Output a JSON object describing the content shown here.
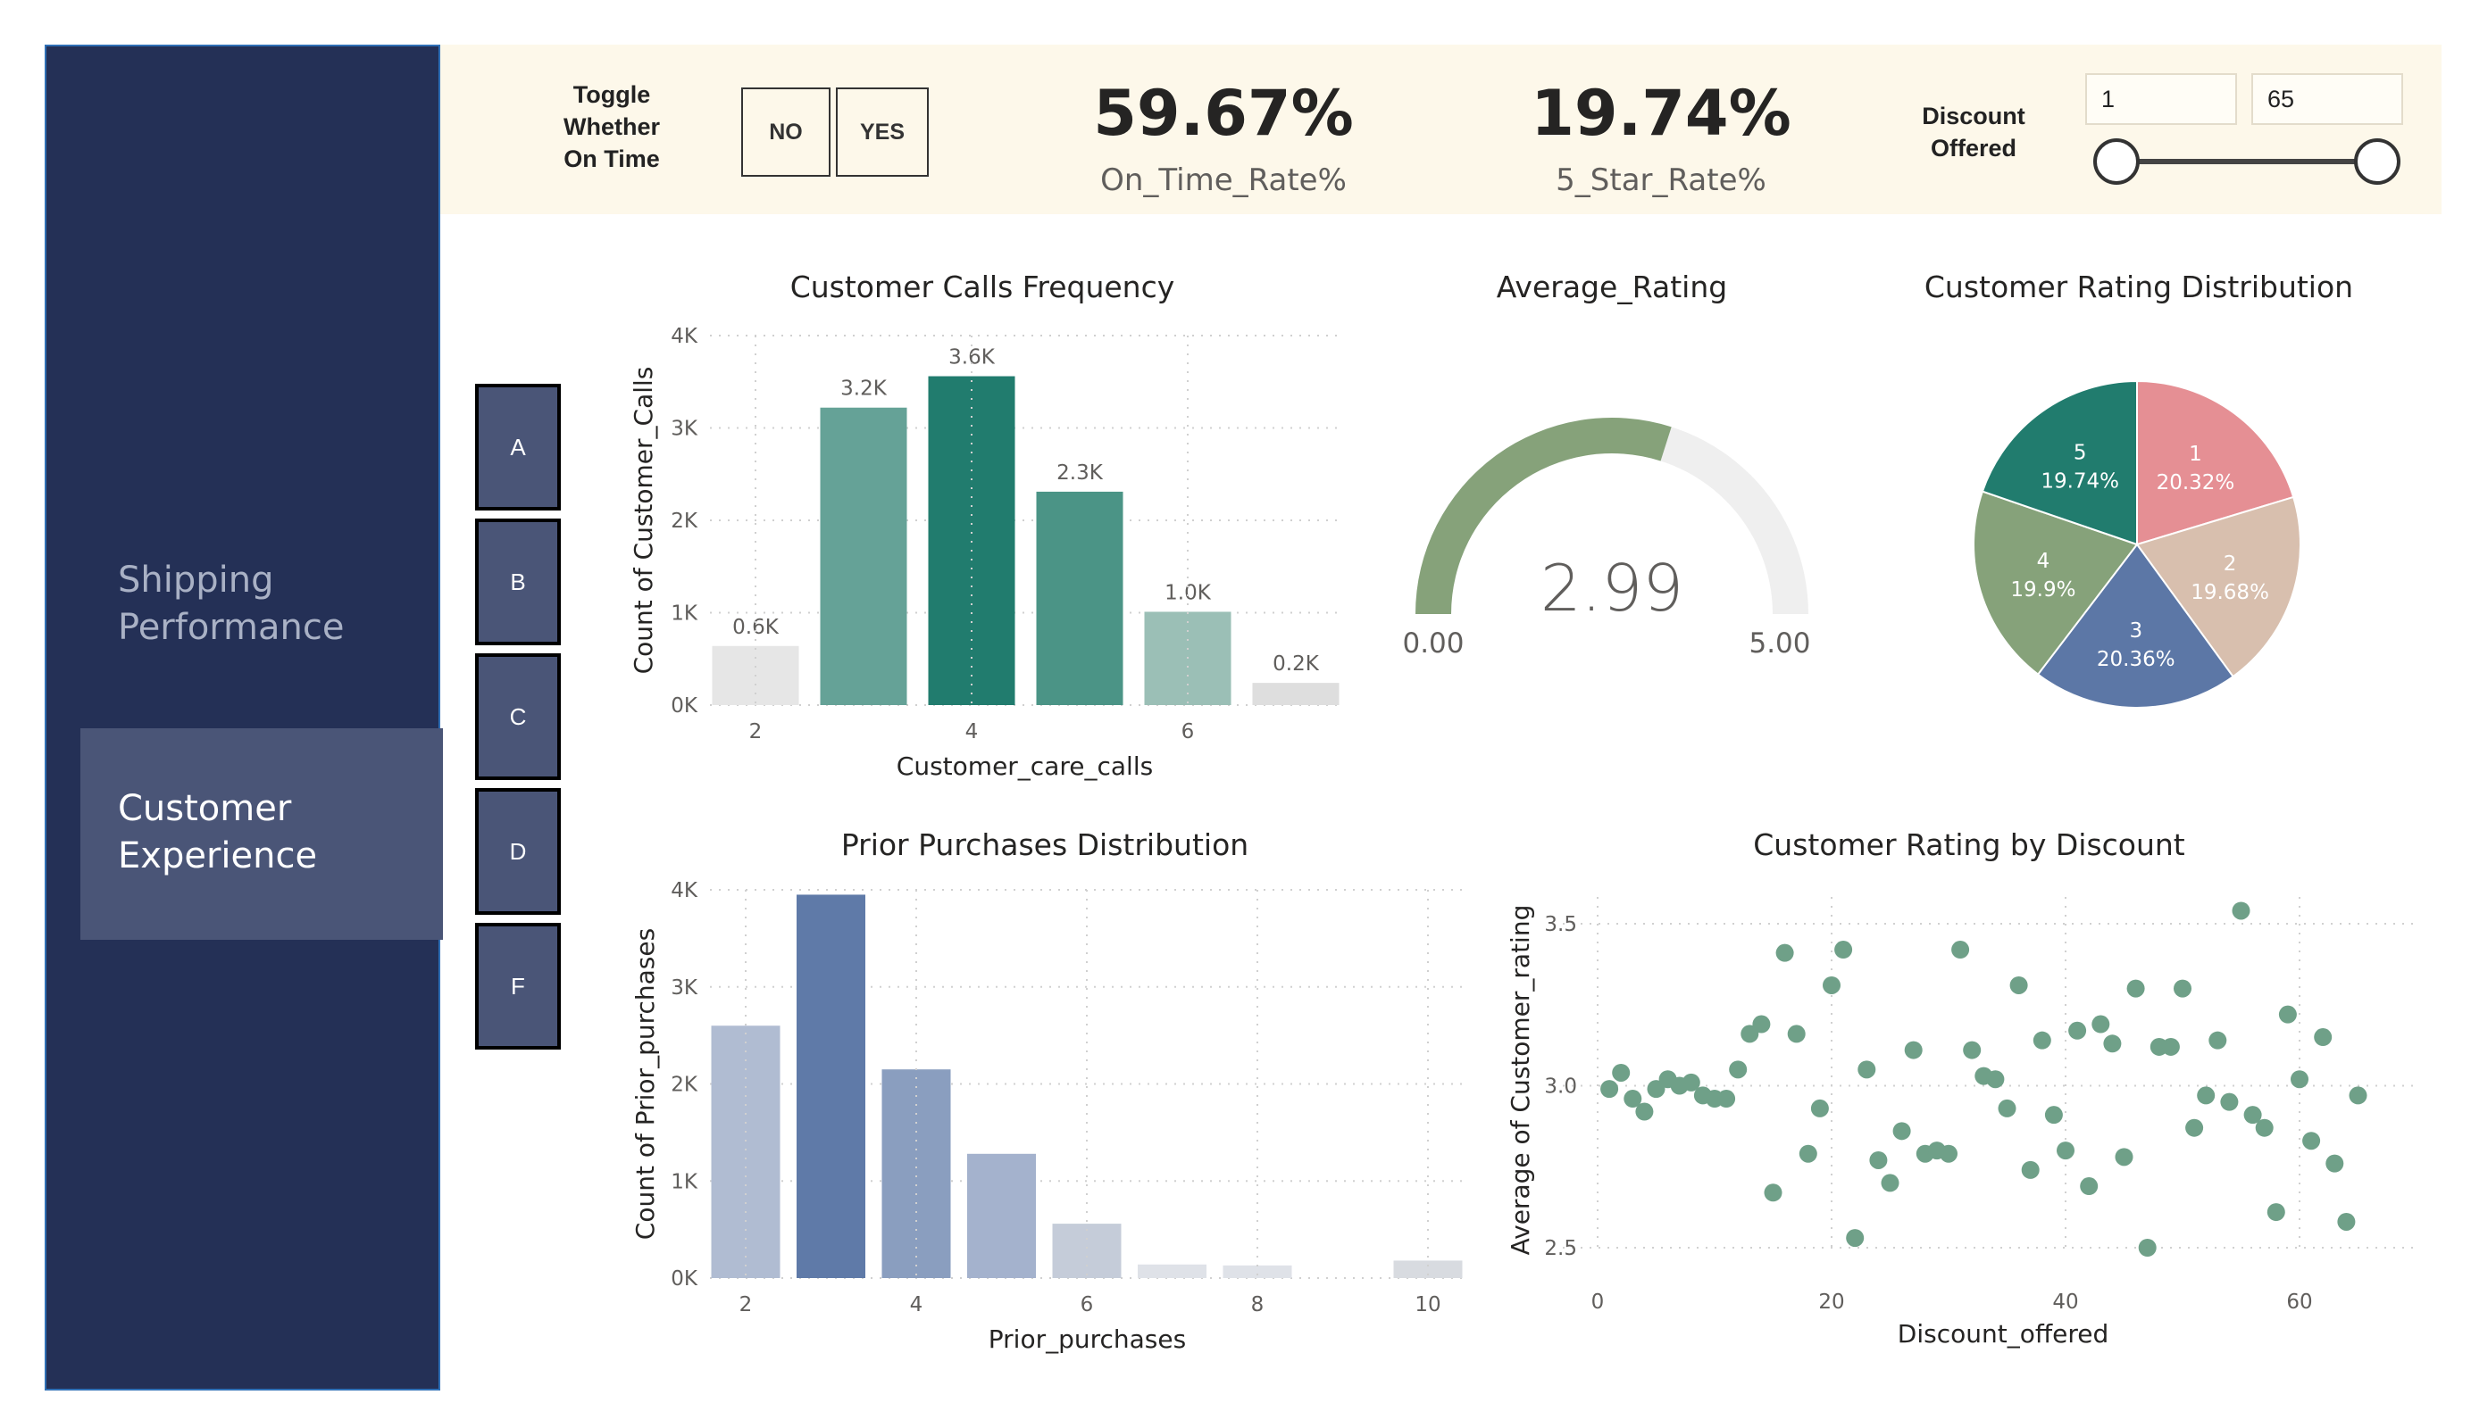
{
  "sidebar": {
    "items": [
      {
        "label": "Shipping Performance"
      },
      {
        "label": "Customer Experience"
      }
    ]
  },
  "topbar": {
    "toggle_label": "Toggle Whether On Time",
    "toggle_options": [
      "NO",
      "YES"
    ],
    "kpis": [
      {
        "value": "59.67%",
        "label": "On_Time_Rate%"
      },
      {
        "value": "19.74%",
        "label": "5_Star_Rate%"
      }
    ],
    "discount": {
      "label": "Discount Offered",
      "min": "1",
      "max": "65"
    }
  },
  "grade_buttons": [
    "A",
    "B",
    "C",
    "D",
    "F"
  ],
  "colors": {
    "sidebar_bg": "#243056",
    "topbar_bg": "#fdf8ea",
    "teal_dark": "#217c6e",
    "green_gauge": "#86a27a",
    "scatter_point": "#6fa088",
    "slate_blue": "#5f7aa8"
  },
  "chart_data": [
    {
      "id": "calls",
      "type": "bar",
      "title": "Customer Calls Frequency",
      "xlabel": "Customer_care_calls",
      "ylabel": "Count of Customer_Calls",
      "categories": [
        2,
        3,
        4,
        5,
        6,
        7
      ],
      "values": [
        640,
        3220,
        3560,
        2310,
        1010,
        240
      ],
      "data_labels": [
        "0.6K",
        "3.2K",
        "3.6K",
        "2.3K",
        "1.0K",
        "0.2K"
      ],
      "bar_colors": [
        "#e6e6e6",
        "#65a297",
        "#217c6e",
        "#4b9486",
        "#9bbfb6",
        "#dedede"
      ],
      "x_ticks": [
        "2",
        "4",
        "6"
      ],
      "y_ticks": [
        "0K",
        "1K",
        "2K",
        "3K",
        "4K"
      ],
      "ylim": [
        0,
        4000
      ]
    },
    {
      "id": "gauge",
      "type": "gauge",
      "title": "Average_Rating",
      "value": 2.99,
      "value_label": "2.99",
      "min": 0,
      "max": 5,
      "min_label": "0.00",
      "max_label": "5.00"
    },
    {
      "id": "rating_pie",
      "type": "pie",
      "title": "Customer Rating Distribution",
      "slices": [
        {
          "label": "1",
          "pct_label": "20.32%",
          "value": 20.32,
          "color": "#e58f94"
        },
        {
          "label": "2",
          "pct_label": "19.68%",
          "value": 19.68,
          "color": "#d8bfae"
        },
        {
          "label": "3",
          "pct_label": "20.36%",
          "value": 20.36,
          "color": "#5c77a6"
        },
        {
          "label": "4",
          "pct_label": "19.9%",
          "value": 19.9,
          "color": "#86a27a"
        },
        {
          "label": "5",
          "pct_label": "19.74%",
          "value": 19.74,
          "color": "#217c6e"
        }
      ]
    },
    {
      "id": "prior",
      "type": "bar",
      "title": "Prior Purchases Distribution",
      "xlabel": "Prior_purchases",
      "ylabel": "Count of Prior_purchases",
      "categories": [
        2,
        3,
        4,
        5,
        6,
        7,
        8,
        10
      ],
      "values": [
        2600,
        3950,
        2150,
        1280,
        560,
        140,
        130,
        180
      ],
      "bar_colors": [
        "#b0bcd2",
        "#5f7aa8",
        "#8a9ebf",
        "#a4b2cd",
        "#c5ccd9",
        "#dfe2e8",
        "#dfe2e8",
        "#d8dbe0"
      ],
      "x_ticks": [
        "2",
        "4",
        "6",
        "8",
        "10"
      ],
      "y_ticks": [
        "0K",
        "1K",
        "2K",
        "3K",
        "4K"
      ],
      "xlim": [
        1.5,
        10.5
      ],
      "ylim": [
        0,
        4000
      ]
    },
    {
      "id": "rating_discount",
      "type": "scatter",
      "title": "Customer Rating by Discount",
      "xlabel": "Discount_offered",
      "ylabel": "Average of Customer_rating",
      "x_ticks": [
        "0",
        "20",
        "40",
        "60"
      ],
      "y_ticks": [
        "2.5",
        "3.0",
        "3.5"
      ],
      "xlim": [
        0,
        70
      ],
      "ylim": [
        2.45,
        3.55
      ],
      "x": [
        1,
        2,
        3,
        4,
        5,
        6,
        7,
        8,
        9,
        10,
        11,
        12,
        13,
        14,
        15,
        16,
        17,
        18,
        19,
        20,
        21,
        22,
        23,
        24,
        25,
        26,
        27,
        28,
        29,
        30,
        31,
        32,
        33,
        34,
        35,
        36,
        37,
        38,
        39,
        40,
        41,
        42,
        43,
        44,
        45,
        46,
        47,
        48,
        49,
        50,
        51,
        52,
        53,
        54,
        55,
        56,
        57,
        58,
        59,
        60,
        61,
        62,
        63,
        64,
        65
      ],
      "y": [
        2.99,
        3.04,
        2.96,
        2.92,
        2.99,
        3.02,
        3.0,
        3.01,
        2.97,
        2.96,
        2.96,
        3.05,
        3.16,
        3.19,
        2.67,
        3.41,
        3.16,
        2.79,
        2.93,
        3.31,
        3.42,
        2.53,
        3.05,
        2.77,
        2.7,
        2.86,
        3.11,
        2.79,
        2.8,
        2.79,
        3.42,
        3.11,
        3.03,
        3.02,
        2.93,
        3.31,
        2.74,
        3.14,
        2.91,
        2.8,
        3.17,
        2.69,
        3.19,
        3.13,
        2.78,
        3.3,
        2.5,
        3.12,
        3.12,
        3.3,
        2.87,
        2.97,
        3.14,
        2.95,
        3.54,
        2.91,
        2.87,
        2.61,
        3.22,
        3.02,
        2.83,
        3.15,
        2.76,
        2.58,
        2.97
      ]
    }
  ]
}
